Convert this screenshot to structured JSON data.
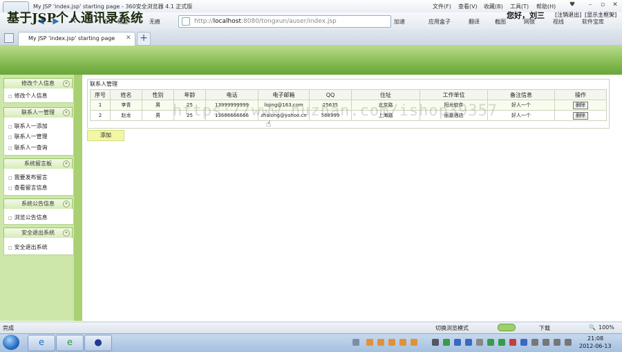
{
  "browser": {
    "window_title": "My JSP 'index.jsp' starting page - 360安全浏览器 4.1 正式版",
    "menu": [
      "文件(F)",
      "查看(V)",
      "收藏(B)",
      "工具(T)",
      "帮助(H)"
    ],
    "url_prefix": "http://",
    "url_host": "localhost",
    "url_rest": ":8080/tongxun/auser/index.jsp",
    "back_label": "恢复",
    "nosearch_label": "无痕",
    "speed_label": "加速",
    "toolbar": [
      "应用盒子",
      "翻译",
      "截图",
      "网银",
      "视线",
      "软件宝库"
    ],
    "tab_title": "My JSP 'index.jsp' starting page",
    "status_text": "完成",
    "view_mode": "切换浏览模式",
    "downloads": "下载",
    "zoom": "100%"
  },
  "header": {
    "title": "基于JSP个人通讯录系统",
    "greeting": "您好，刘三",
    "logout": "[注销退出]",
    "home": "[显示主框架]"
  },
  "sidebar": [
    {
      "title": "修改个人信息",
      "items": [
        "修改个人信息"
      ]
    },
    {
      "title": "联系人一管理",
      "items": [
        "联系人一添加",
        "联系人一管理",
        "联系人一查询"
      ]
    },
    {
      "title": "系统留言板",
      "items": [
        "我要发布留言",
        "查看留言信息"
      ]
    },
    {
      "title": "系统公告信息",
      "items": [
        "浏览公告信息"
      ]
    },
    {
      "title": "安全退出系统",
      "items": [
        "安全退出系统"
      ]
    }
  ],
  "panel": {
    "title": "联系人管理",
    "columns": [
      "序号",
      "姓名",
      "性别",
      "年龄",
      "电话",
      "电子邮箱",
      "QQ",
      "住址",
      "工作单位",
      "备注信息",
      "操作"
    ],
    "rows": [
      [
        "1",
        "李青",
        "男",
        "25",
        "13999999999",
        "liqing@163.com",
        "25635",
        "北京路",
        "阳光软件",
        "好人一个",
        "删除"
      ],
      [
        "2",
        "赵龙",
        "男",
        "25",
        "13666666666",
        "zhalong@yahoo.cn",
        "568999",
        "上海路",
        "丽嘉酒店",
        "好人一个",
        "删除"
      ]
    ],
    "add_button": "添加"
  },
  "watermark": "https://www.huzhan.com/ishop39357",
  "taskbar": {
    "time": "21:08",
    "date": "2012-06-13"
  }
}
